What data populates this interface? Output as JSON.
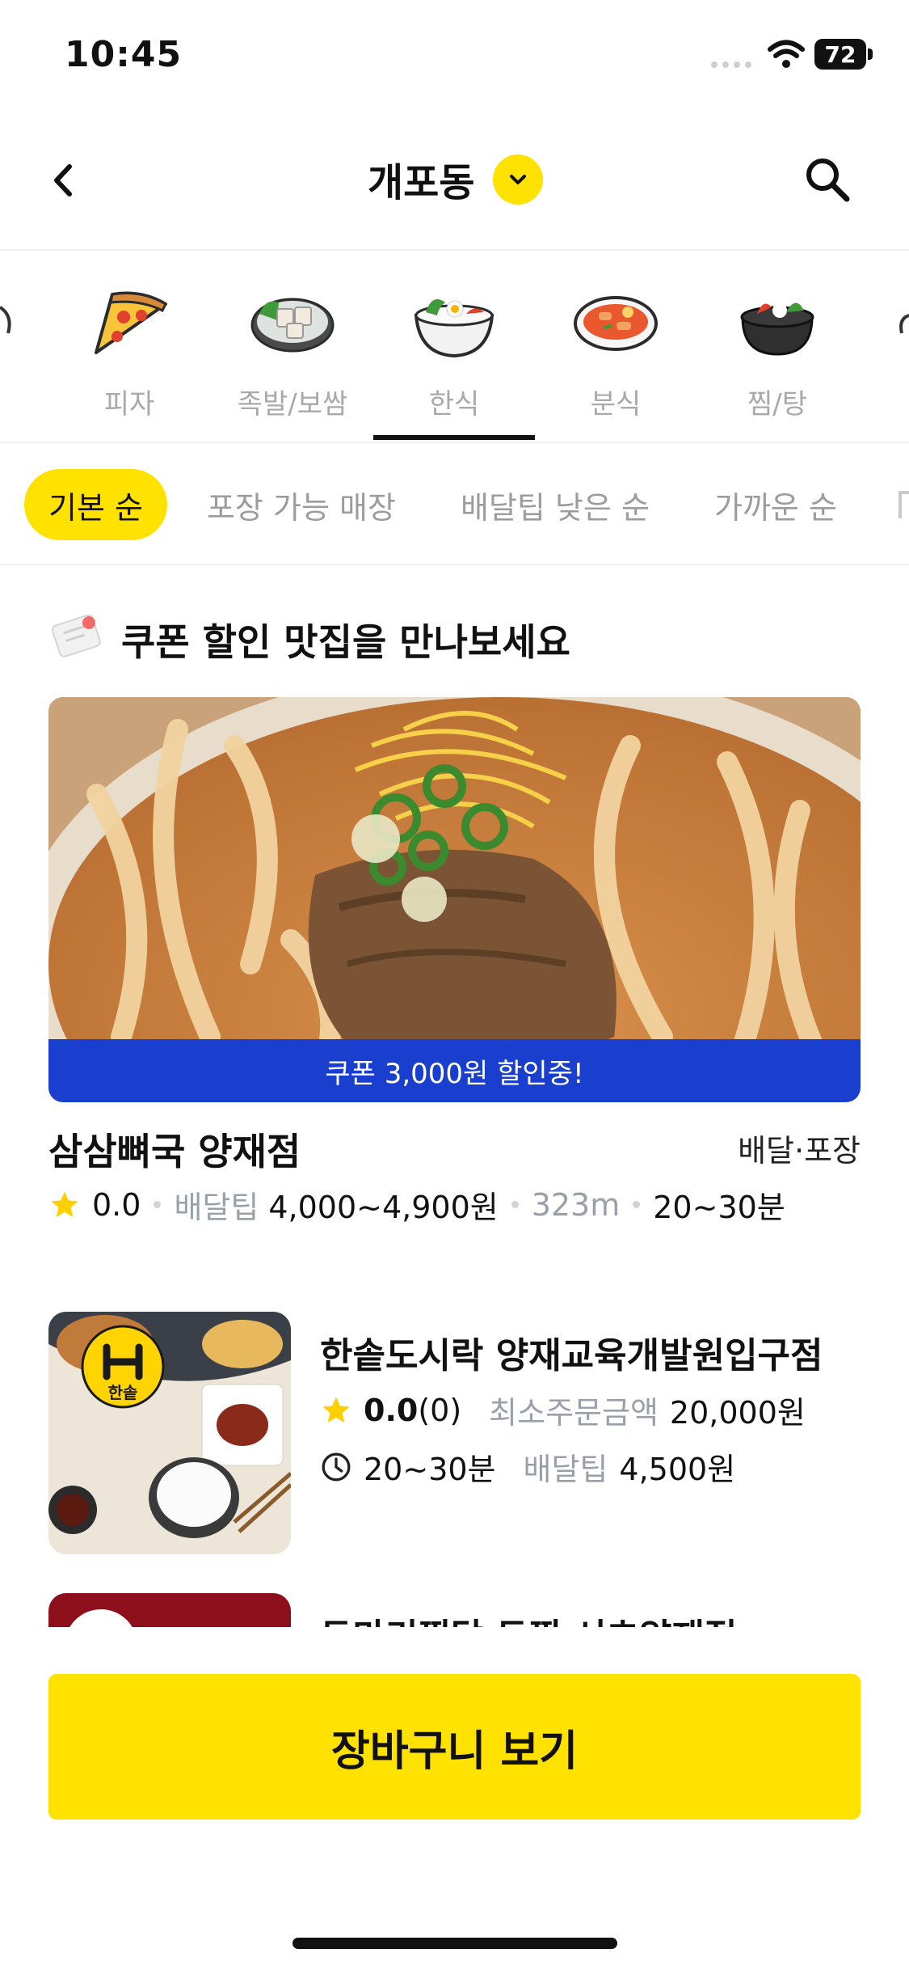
{
  "status": {
    "time": "10:45",
    "battery": "72"
  },
  "header": {
    "location": "개포동"
  },
  "categories": [
    {
      "label": "피자",
      "icon": "pizza-icon"
    },
    {
      "label": "족발/보쌈",
      "icon": "bossam-icon"
    },
    {
      "label": "한식",
      "icon": "bibimbap-icon",
      "active": true
    },
    {
      "label": "분식",
      "icon": "tteokbokki-icon"
    },
    {
      "label": "찜/탕",
      "icon": "stew-pot-icon"
    }
  ],
  "filters": [
    {
      "label": "기본 순",
      "active": true
    },
    {
      "label": "포장 가능 매장"
    },
    {
      "label": "배달팁 낮은 순"
    },
    {
      "label": "가까운 순"
    }
  ],
  "coupon_section": {
    "title": "쿠폰 할인 맛집을 만나보세요",
    "banner": "쿠폰 3,000원 할인중!",
    "store": {
      "name": "삼삼뼈국 양재점",
      "type": "배달·포장",
      "rating": "0.0",
      "delivery_tip_label": "배달팁",
      "delivery_tip": "4,000~4,900원",
      "distance": "323m",
      "time": "20~30분"
    }
  },
  "stores": [
    {
      "name": "한솥도시락 양재교육개발원입구점",
      "logo_text": "한솥",
      "rating": "0.0",
      "review_count": "(0)",
      "min_order_label": "최소주문금액",
      "min_order": "20,000원",
      "time": "20~30분",
      "delivery_tip_label": "배달팁",
      "delivery_tip": "4,500원"
    },
    {
      "name": "두마리찜닭 두찜 서초양재점"
    }
  ],
  "cart_button": "장바구니 보기",
  "colors": {
    "accent": "#ffe200",
    "banner": "#1a3fcf",
    "muted": "#9aa0aa"
  }
}
